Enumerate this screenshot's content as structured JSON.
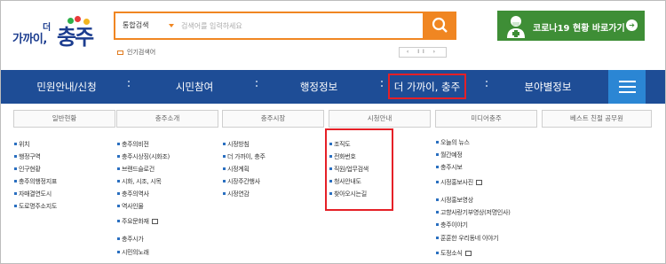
{
  "logo": {
    "small_text": "가까이,",
    "small_super": "더",
    "big_text": "충주"
  },
  "search": {
    "select_label": "통합검색",
    "placeholder": "검색어를 입력하세요"
  },
  "popular": {
    "label": "인기검색어",
    "pager": "‹ II ›"
  },
  "covid": {
    "label": "코로나19 현황 바로가기",
    "arrow": "➔"
  },
  "nav": {
    "items": [
      "민원안내/신청",
      "시민참여",
      "행정정보",
      "더 가까이, 충주",
      "분야별정보"
    ]
  },
  "columns": [
    {
      "head": "일반현황",
      "items": [
        "위치",
        "행정구역",
        "인구현황",
        "충주의행정지표",
        "자매결연도시",
        "도로명주소지도"
      ]
    },
    {
      "head": "충주소개",
      "items": [
        "충주의비전",
        "충주시상징(시화조)",
        "브랜드슬로건",
        "시화, 시조, 시목",
        "충주의역사",
        "역사인물",
        "주요문화재",
        "충주시가",
        "시민의노래"
      ]
    },
    {
      "head": "충주시장",
      "items": [
        "시정방침",
        "더 가까이, 충주",
        "시정계획",
        "시장주간행사",
        "시정연감"
      ]
    },
    {
      "head": "시청안내",
      "items": [
        "조직도",
        "전화번호",
        "직원/업무검색",
        "청사안내도",
        "찾아오시는길"
      ]
    },
    {
      "head": "미디어충주",
      "items": [
        "오늘의 뉴스",
        "월간예정",
        "충주시보",
        "시정홍보사진",
        "시정홍보영상",
        "고향사랑기부영상(저명인사)",
        "충주이야기",
        "훈훈한 우리동네 이야기",
        "도정소식"
      ]
    },
    {
      "head": "베스트 친절 공무원",
      "items": []
    }
  ],
  "colors": {
    "nav": "#1e4d96",
    "accent": "#f08622",
    "covid": "#3e8e36",
    "highlight": "#e52027"
  }
}
